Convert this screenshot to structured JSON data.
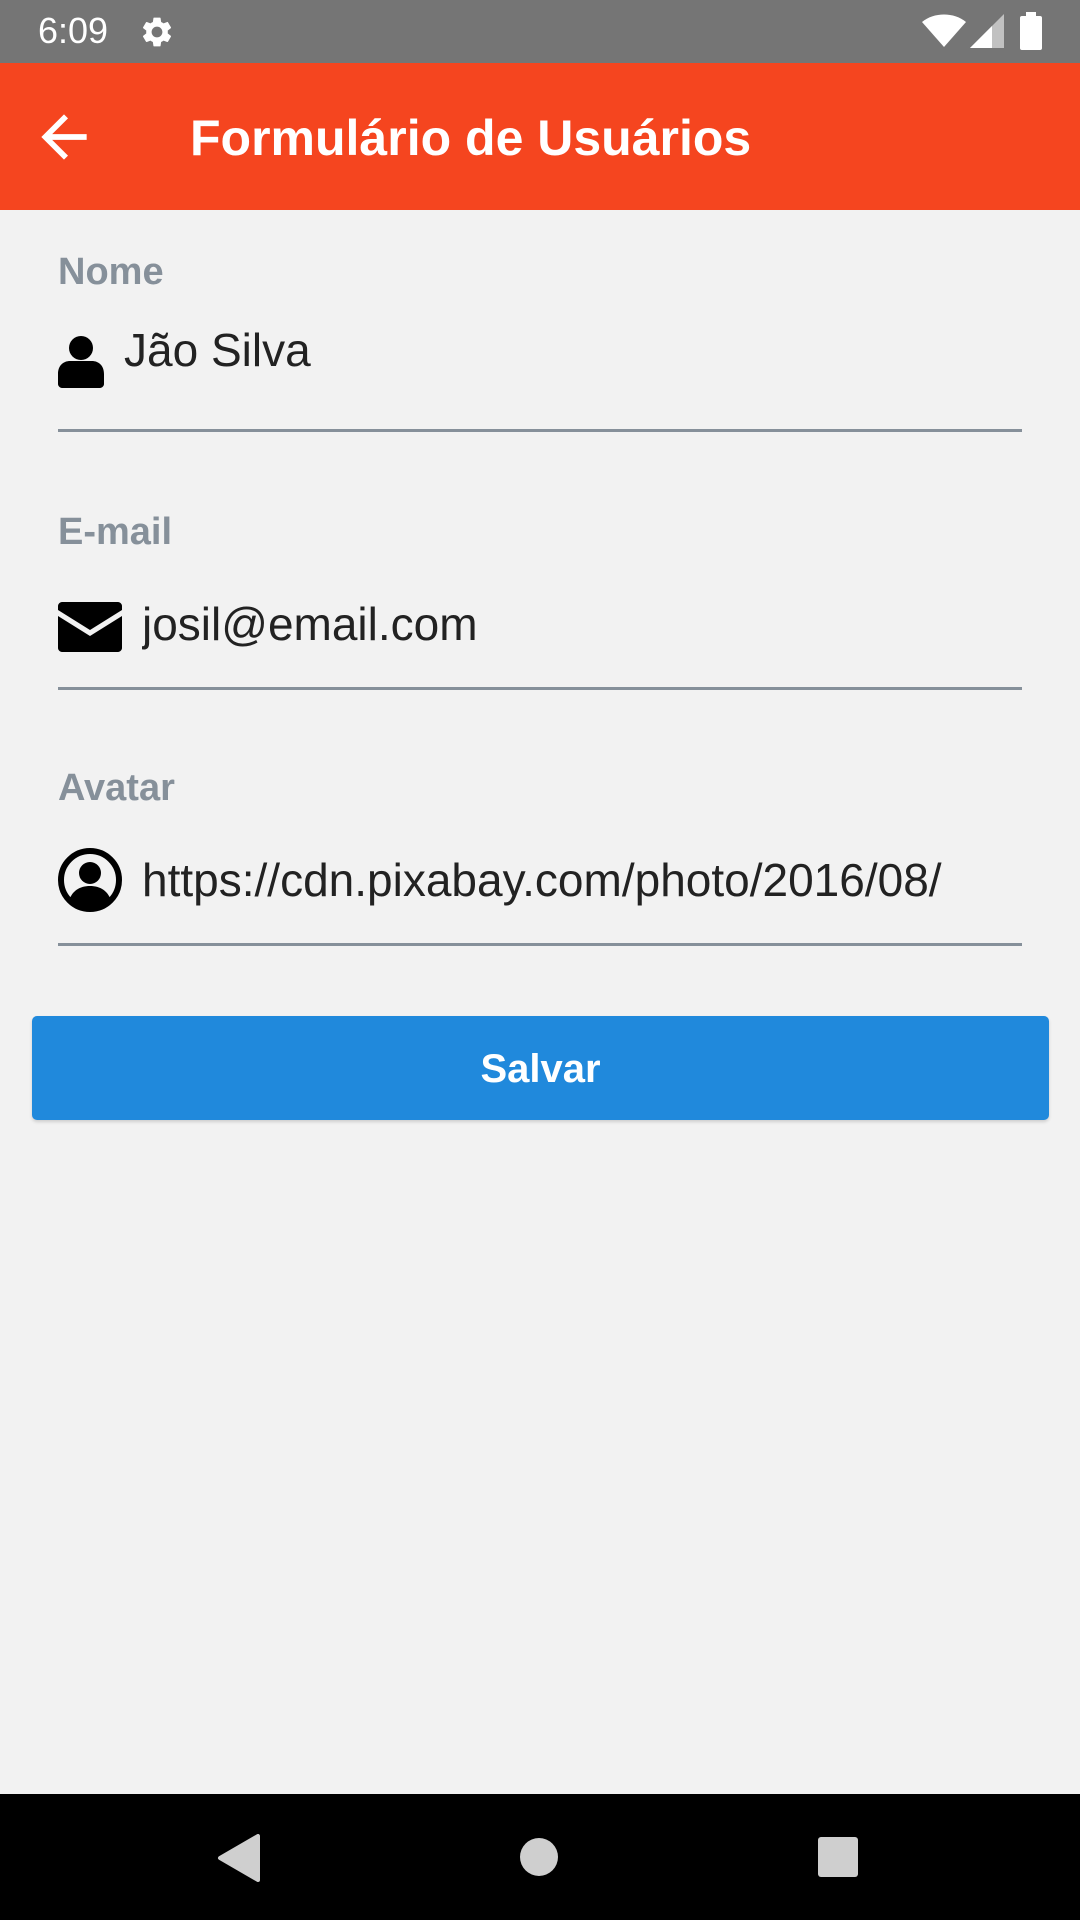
{
  "status_bar": {
    "time": "6:09",
    "icons": [
      "gear-icon",
      "wifi-icon",
      "signal-icon",
      "battery-icon"
    ]
  },
  "app_bar": {
    "title": "Formulário de Usuários",
    "back_icon": "arrow-left-icon",
    "background_color": "#f5451f"
  },
  "form": {
    "name": {
      "label": "Nome",
      "value": "Jão Silva",
      "icon": "user-icon"
    },
    "email": {
      "label": "E-mail",
      "value": "josil@email.com",
      "icon": "envelope-icon"
    },
    "avatar": {
      "label": "Avatar",
      "value": "https://cdn.pixabay.com/photo/2016/08/",
      "icon": "user-circle-icon"
    },
    "label_color": "#86909a"
  },
  "save_button": {
    "label": "Salvar",
    "color": "#2089dc"
  },
  "nav_bar": {
    "icons": [
      "nav-back-icon",
      "nav-home-icon",
      "nav-recents-icon"
    ]
  }
}
